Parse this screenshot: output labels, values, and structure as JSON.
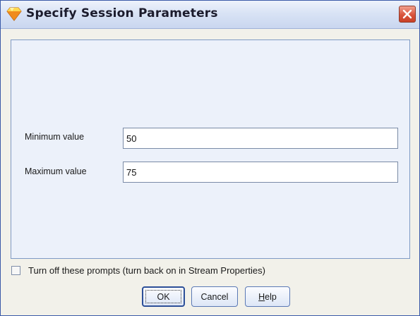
{
  "window": {
    "title": "Specify Session Parameters",
    "icon": "diamond-icon",
    "close_icon": "close-icon"
  },
  "fields": [
    {
      "label": "Minimum value",
      "value": "50"
    },
    {
      "label": "Maximum value",
      "value": "75"
    }
  ],
  "prompt_toggle": {
    "label": "Turn off these prompts (turn back on in Stream Properties)",
    "checked": false
  },
  "buttons": {
    "ok": "OK",
    "cancel": "Cancel",
    "help_prefix": "",
    "help_mnemonic": "H",
    "help_rest": "elp"
  },
  "colors": {
    "titlebar": "#d9e3f5",
    "panel": "#ecf1fa",
    "close": "#d9543c",
    "icon_top": "#ffd54a",
    "icon_bottom": "#f08a1c"
  }
}
